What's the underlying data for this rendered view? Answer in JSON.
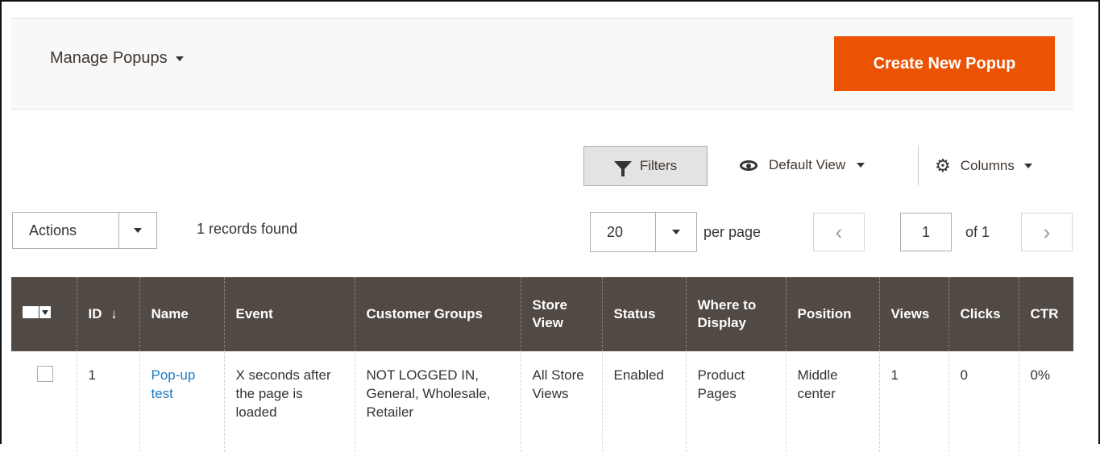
{
  "header": {
    "title": "Manage Popups",
    "create_label": "Create New Popup",
    "accent": "#eb5202"
  },
  "toolbar": {
    "filters_label": "Filters",
    "view_label": "Default View",
    "columns_label": "Columns",
    "actions_label": "Actions",
    "records_found": "1 records found",
    "per_page_value": "20",
    "per_page_label": "per page",
    "page_current": "1",
    "page_of": "of 1"
  },
  "table": {
    "columns": [
      "ID",
      "Name",
      "Event",
      "Customer Groups",
      "Store View",
      "Status",
      "Where to Display",
      "Position",
      "Views",
      "Clicks",
      "CTR"
    ],
    "sort_icon": "arrow-down",
    "rows": [
      {
        "id": "1",
        "name": "Pop-up test",
        "event": "X seconds after the page is loaded",
        "customer_groups": "NOT LOGGED IN, General, Wholesale, Retailer",
        "store_view": "All Store Views",
        "status": "Enabled",
        "where_to_display": "Product Pages",
        "position": "Middle center",
        "views": "1",
        "clicks": "0",
        "ctr": "0%"
      }
    ]
  }
}
